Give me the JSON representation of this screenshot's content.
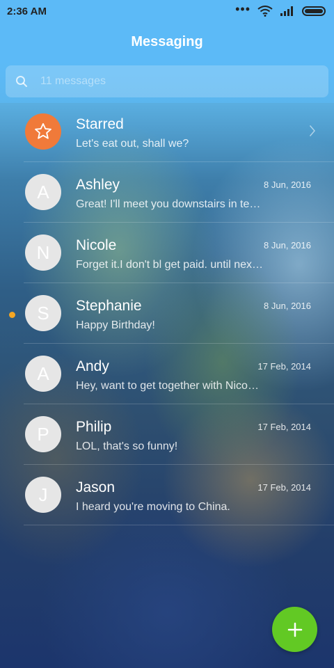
{
  "status_bar": {
    "time": "2:36 AM",
    "icons": [
      "more-dots-icon",
      "wifi-icon",
      "signal-icon",
      "battery-icon"
    ]
  },
  "header": {
    "title": "Messaging"
  },
  "search": {
    "placeholder": "11 messages",
    "icon": "search-icon"
  },
  "conversations": [
    {
      "name": "Starred",
      "preview": "Let's eat out, shall we?",
      "avatar": "star-icon",
      "avatar_color": "#f07a3a"
    },
    {
      "name": "Ashley",
      "initial": "A",
      "date": "8 Jun, 2016",
      "preview": "Great! I'll meet you downstairs in te…"
    },
    {
      "name": "Nicole",
      "initial": "N",
      "date": "8 Jun, 2016",
      "preview": "Forget it.I don't bl get paid. until nex…"
    },
    {
      "name": "Stephanie",
      "initial": "S",
      "date": "8 Jun, 2016",
      "preview": "Happy Birthday!",
      "unread": true,
      "unread_color": "#f5a623"
    },
    {
      "name": "Andy",
      "initial": "A",
      "date": "17 Feb, 2014",
      "preview": "Hey, want to get together with Nico…"
    },
    {
      "name": "Philip",
      "initial": "P",
      "date": "17 Feb, 2014",
      "preview": "LOL, that's so funny!"
    },
    {
      "name": "Jason",
      "initial": "J",
      "date": "17 Feb, 2014",
      "preview": "I heard you're moving to China."
    }
  ],
  "fab": {
    "icon": "plus-icon",
    "color": "#62c924"
  },
  "colors": {
    "header": "#5cbaf7",
    "avatar": "#e6e6e6"
  }
}
